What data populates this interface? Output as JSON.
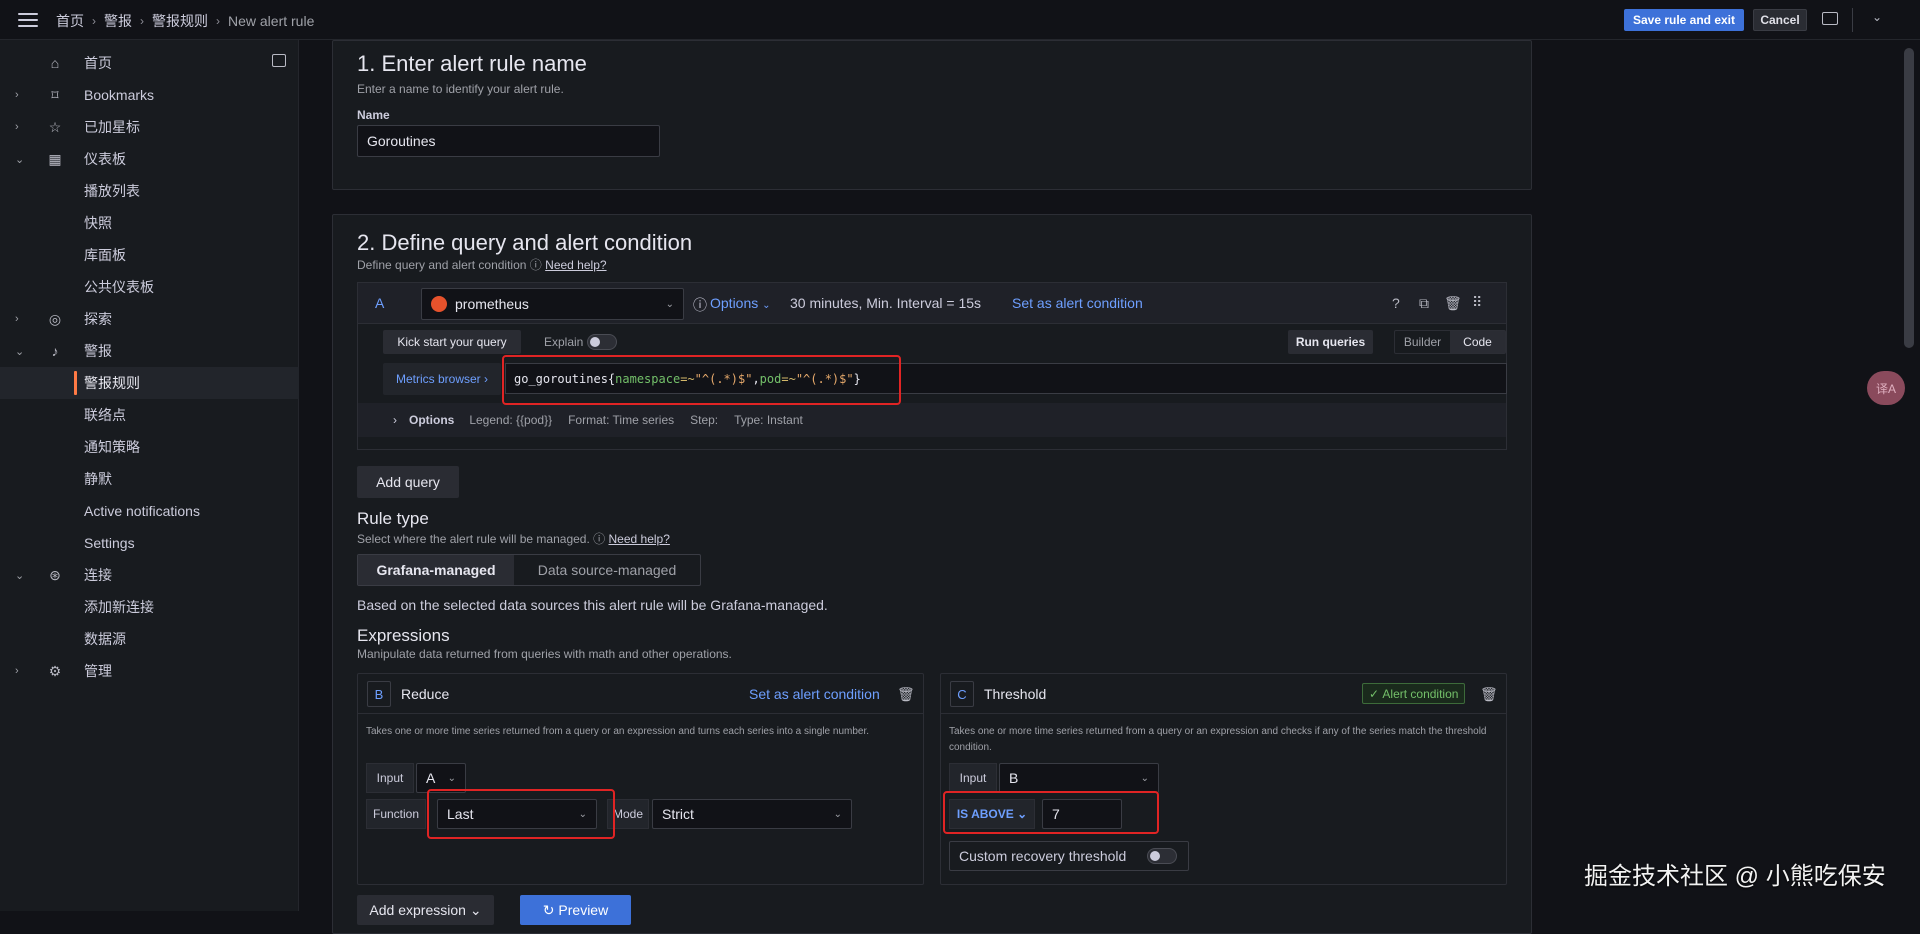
{
  "topbar": {
    "breadcrumbs": [
      "首页",
      "警报",
      "警报规则",
      "New alert rule"
    ],
    "save_label": "Save rule and exit",
    "cancel_label": "Cancel"
  },
  "sidebar": {
    "items": [
      {
        "label": "首页",
        "icon": "home-icon"
      },
      {
        "label": "Bookmarks",
        "icon": "bookmark-icon"
      },
      {
        "label": "已加星标",
        "icon": "star-icon"
      },
      {
        "label": "仪表板",
        "icon": "dashboard-icon"
      },
      {
        "label": "播放列表"
      },
      {
        "label": "快照"
      },
      {
        "label": "库面板"
      },
      {
        "label": "公共仪表板"
      },
      {
        "label": "探索",
        "icon": "compass-icon"
      },
      {
        "label": "警报",
        "icon": "bell-icon"
      },
      {
        "label": "警报规则"
      },
      {
        "label": "联络点"
      },
      {
        "label": "通知策略"
      },
      {
        "label": "静默"
      },
      {
        "label": "Active notifications"
      },
      {
        "label": "Settings"
      },
      {
        "label": "连接",
        "icon": "connections-icon"
      },
      {
        "label": "添加新连接"
      },
      {
        "label": "数据源"
      },
      {
        "label": "管理",
        "icon": "gear-icon"
      }
    ]
  },
  "section1": {
    "title": "1. Enter alert rule name",
    "subtitle": "Enter a name to identify your alert rule.",
    "name_label": "Name",
    "name_value": "Goroutines"
  },
  "section2": {
    "title": "2. Define query and alert condition",
    "subtitle": "Define query and alert condition",
    "help": "Need help?",
    "query": {
      "letter": "A",
      "datasource": "prometheus",
      "options": "Options",
      "options_info": "30 minutes, Min. Interval = 15s",
      "set_condition": "Set as alert condition",
      "kick_start": "Kick start your query",
      "explain": "Explain",
      "run": "Run queries",
      "builder": "Builder",
      "code": "Code",
      "metrics_browser": "Metrics browser",
      "expr_metric": "go_goroutines{",
      "expr_l1": "namespace",
      "expr_op1": "=~",
      "expr_v1": "\"^(.*)$\"",
      "expr_comma": ",",
      "expr_l2": "pod",
      "expr_op2": "=~",
      "expr_v2": "\"^(.*)$\"",
      "expr_close": "}",
      "opt_label": "Options",
      "legend": "Legend: {{pod}}",
      "format": "Format: Time series",
      "step": "Step:",
      "type": "Type: Instant"
    },
    "add_query": "Add query",
    "rule_type": {
      "title": "Rule type",
      "subtitle": "Select where the alert rule will be managed.",
      "help": "Need help?",
      "grafana": "Grafana-managed",
      "datasource": "Data source-managed",
      "info": "Based on the selected data sources this alert rule will be Grafana-managed."
    },
    "expressions": {
      "title": "Expressions",
      "subtitle": "Manipulate data returned from queries with math and other operations.",
      "reduce": {
        "letter": "B",
        "name": "Reduce",
        "set_condition": "Set as alert condition",
        "desc": "Takes one or more time series returned from a query or an expression and turns each series into a single number.",
        "input_label": "Input",
        "input_value": "A",
        "function_label": "Function",
        "function_value": "Last",
        "mode_label": "Mode",
        "mode_value": "Strict"
      },
      "threshold": {
        "letter": "C",
        "name": "Threshold",
        "badge": "Alert condition",
        "desc": "Takes one or more time series returned from a query or an expression and checks if any of the series match the threshold condition.",
        "input_label": "Input",
        "input_value": "B",
        "is_above": "IS ABOVE",
        "value": "7",
        "recovery": "Custom recovery threshold"
      }
    },
    "add_expression": "Add expression",
    "preview": "Preview"
  },
  "watermark": "掘金技术社区 @ 小熊吃保安",
  "translate_badge": "译A",
  "colors": {
    "accent": "#3d71d9",
    "link": "#6e9fff",
    "highlight": "#e02424",
    "active_bar": "#ff7a45"
  }
}
